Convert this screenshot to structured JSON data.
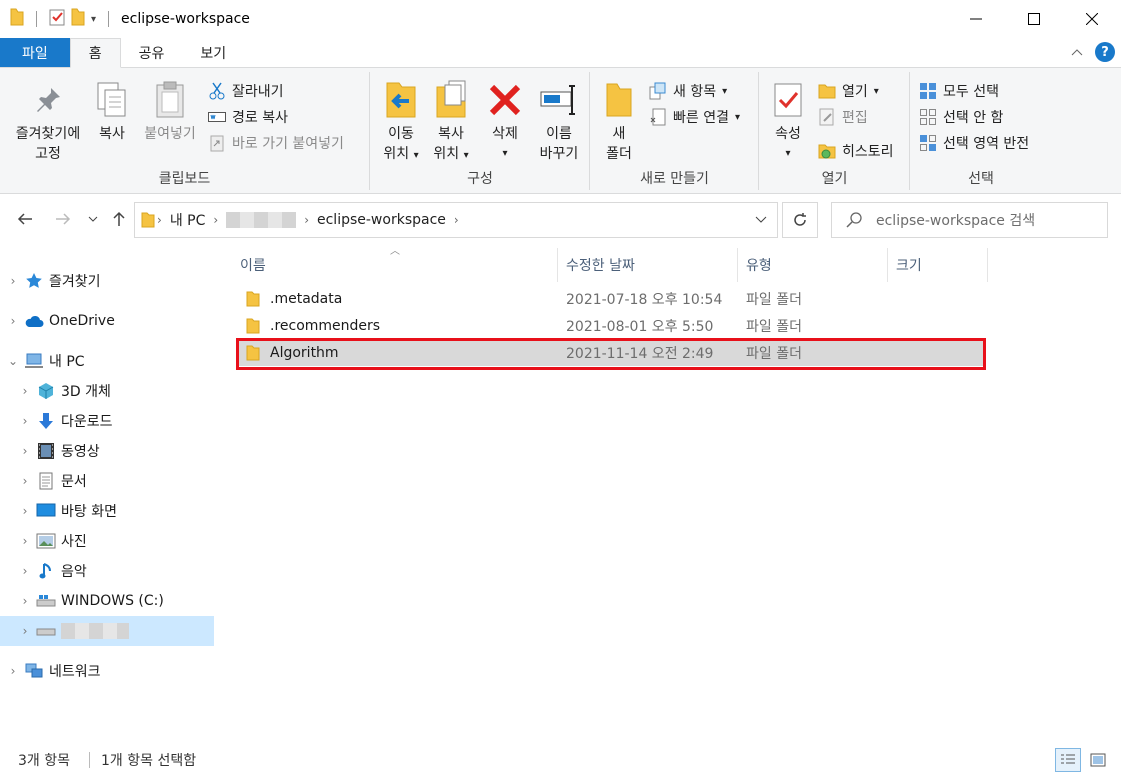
{
  "window": {
    "title": "eclipse-workspace",
    "minimize_icon": "minimize-icon",
    "maximize_icon": "maximize-icon",
    "close_icon": "close-icon"
  },
  "tabs": [
    {
      "label": "파일"
    },
    {
      "label": "홈"
    },
    {
      "label": "공유"
    },
    {
      "label": "보기"
    }
  ],
  "ribbon": {
    "clipboard": {
      "pin_line1": "즐겨찾기에",
      "pin_line2": "고정",
      "copy": "복사",
      "paste": "붙여넣기",
      "cut": "잘라내기",
      "copy_path": "경로 복사",
      "paste_shortcut": "바로 가기 붙여넣기",
      "label": "클립보드"
    },
    "organize": {
      "move_line1": "이동",
      "move_line2": "위치",
      "copyto_line1": "복사",
      "copyto_line2": "위치",
      "delete": "삭제",
      "rename_line1": "이름",
      "rename_line2": "바꾸기",
      "label": "구성"
    },
    "new": {
      "folder_line1": "새",
      "folder_line2": "폴더",
      "new_item": "새 항목",
      "easy_access": "빠른 연결",
      "label": "새로 만들기"
    },
    "open": {
      "properties": "속성",
      "open": "열기",
      "edit": "편집",
      "history": "히스토리",
      "label": "열기"
    },
    "select": {
      "select_all": "모두 선택",
      "select_none": "선택 안 함",
      "invert": "선택 영역 반전",
      "label": "선택"
    }
  },
  "address": {
    "crumb1": "내 PC",
    "crumb3": "eclipse-workspace",
    "search_placeholder": "eclipse-workspace 검색"
  },
  "sidebar": {
    "items": [
      {
        "label": "즐겨찾기",
        "icon": "star-icon"
      },
      {
        "label": "OneDrive",
        "icon": "cloud-icon"
      },
      {
        "label": "내 PC",
        "icon": "computer-icon"
      },
      {
        "label": "3D 개체",
        "icon": "cube-icon"
      },
      {
        "label": "다운로드",
        "icon": "download-icon"
      },
      {
        "label": "동영상",
        "icon": "video-icon"
      },
      {
        "label": "문서",
        "icon": "document-icon"
      },
      {
        "label": "바탕 화면",
        "icon": "desktop-icon"
      },
      {
        "label": "사진",
        "icon": "picture-icon"
      },
      {
        "label": "음악",
        "icon": "music-icon"
      },
      {
        "label": "WINDOWS (C:)",
        "icon": "drive-icon"
      },
      {
        "label": "",
        "icon": "drive-icon"
      },
      {
        "label": "네트워크",
        "icon": "network-icon"
      }
    ]
  },
  "columns": {
    "name": "이름",
    "date": "수정한 날짜",
    "type": "유형",
    "size": "크기"
  },
  "files": [
    {
      "name": ".metadata",
      "date": "2021-07-18 오후 10:54",
      "type": "파일 폴더"
    },
    {
      "name": ".recommenders",
      "date": "2021-08-01 오후 5:50",
      "type": "파일 폴더"
    },
    {
      "name": "Algorithm",
      "date": "2021-11-14 오전 2:49",
      "type": "파일 폴더"
    }
  ],
  "status": {
    "count": "3개 항목",
    "selected": "1개 항목 선택함"
  },
  "colors": {
    "accent": "#1979ca",
    "highlight": "#e8101a",
    "folder": "#f5c342"
  }
}
